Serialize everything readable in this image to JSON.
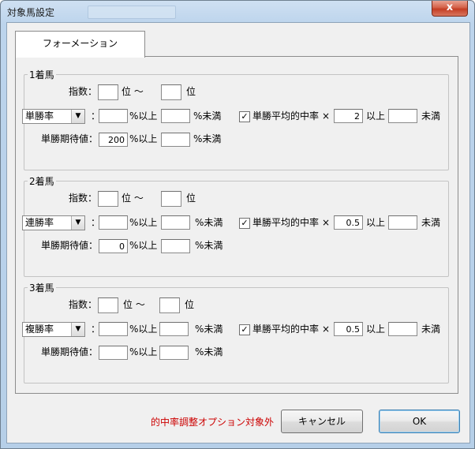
{
  "window": {
    "title": "対象馬設定",
    "blurred_title_fragment": "",
    "close_symbol": "x"
  },
  "tabs": [
    {
      "label": "フォーメーション"
    }
  ],
  "common": {
    "count_label": "指数：",
    "rank_from": "位 〜",
    "rank_to": "位",
    "colon": "：",
    "pct_over": "%以上",
    "pct_under": "%未満",
    "avg_check": "単勝平均的中率",
    "times": "×",
    "over": "以上",
    "under": "未満",
    "expect_label": "単勝期待値：",
    "check_mark": "✓",
    "combo_arrow": "▼"
  },
  "groups": [
    {
      "title": "1着馬",
      "rate_type": "単勝率",
      "multiplier": "2",
      "expect_value": "200"
    },
    {
      "title": "2着馬",
      "rate_type": "連勝率",
      "multiplier": "0.5",
      "expect_value": "0"
    },
    {
      "title": "3着馬",
      "rate_type": "複勝率",
      "multiplier": "0.5",
      "expect_value": ""
    }
  ],
  "footer": {
    "note": "的中率調整オプション対象外",
    "cancel_label": "キャンセル",
    "ok_label": "OK",
    "note_color": "#cc0000"
  }
}
